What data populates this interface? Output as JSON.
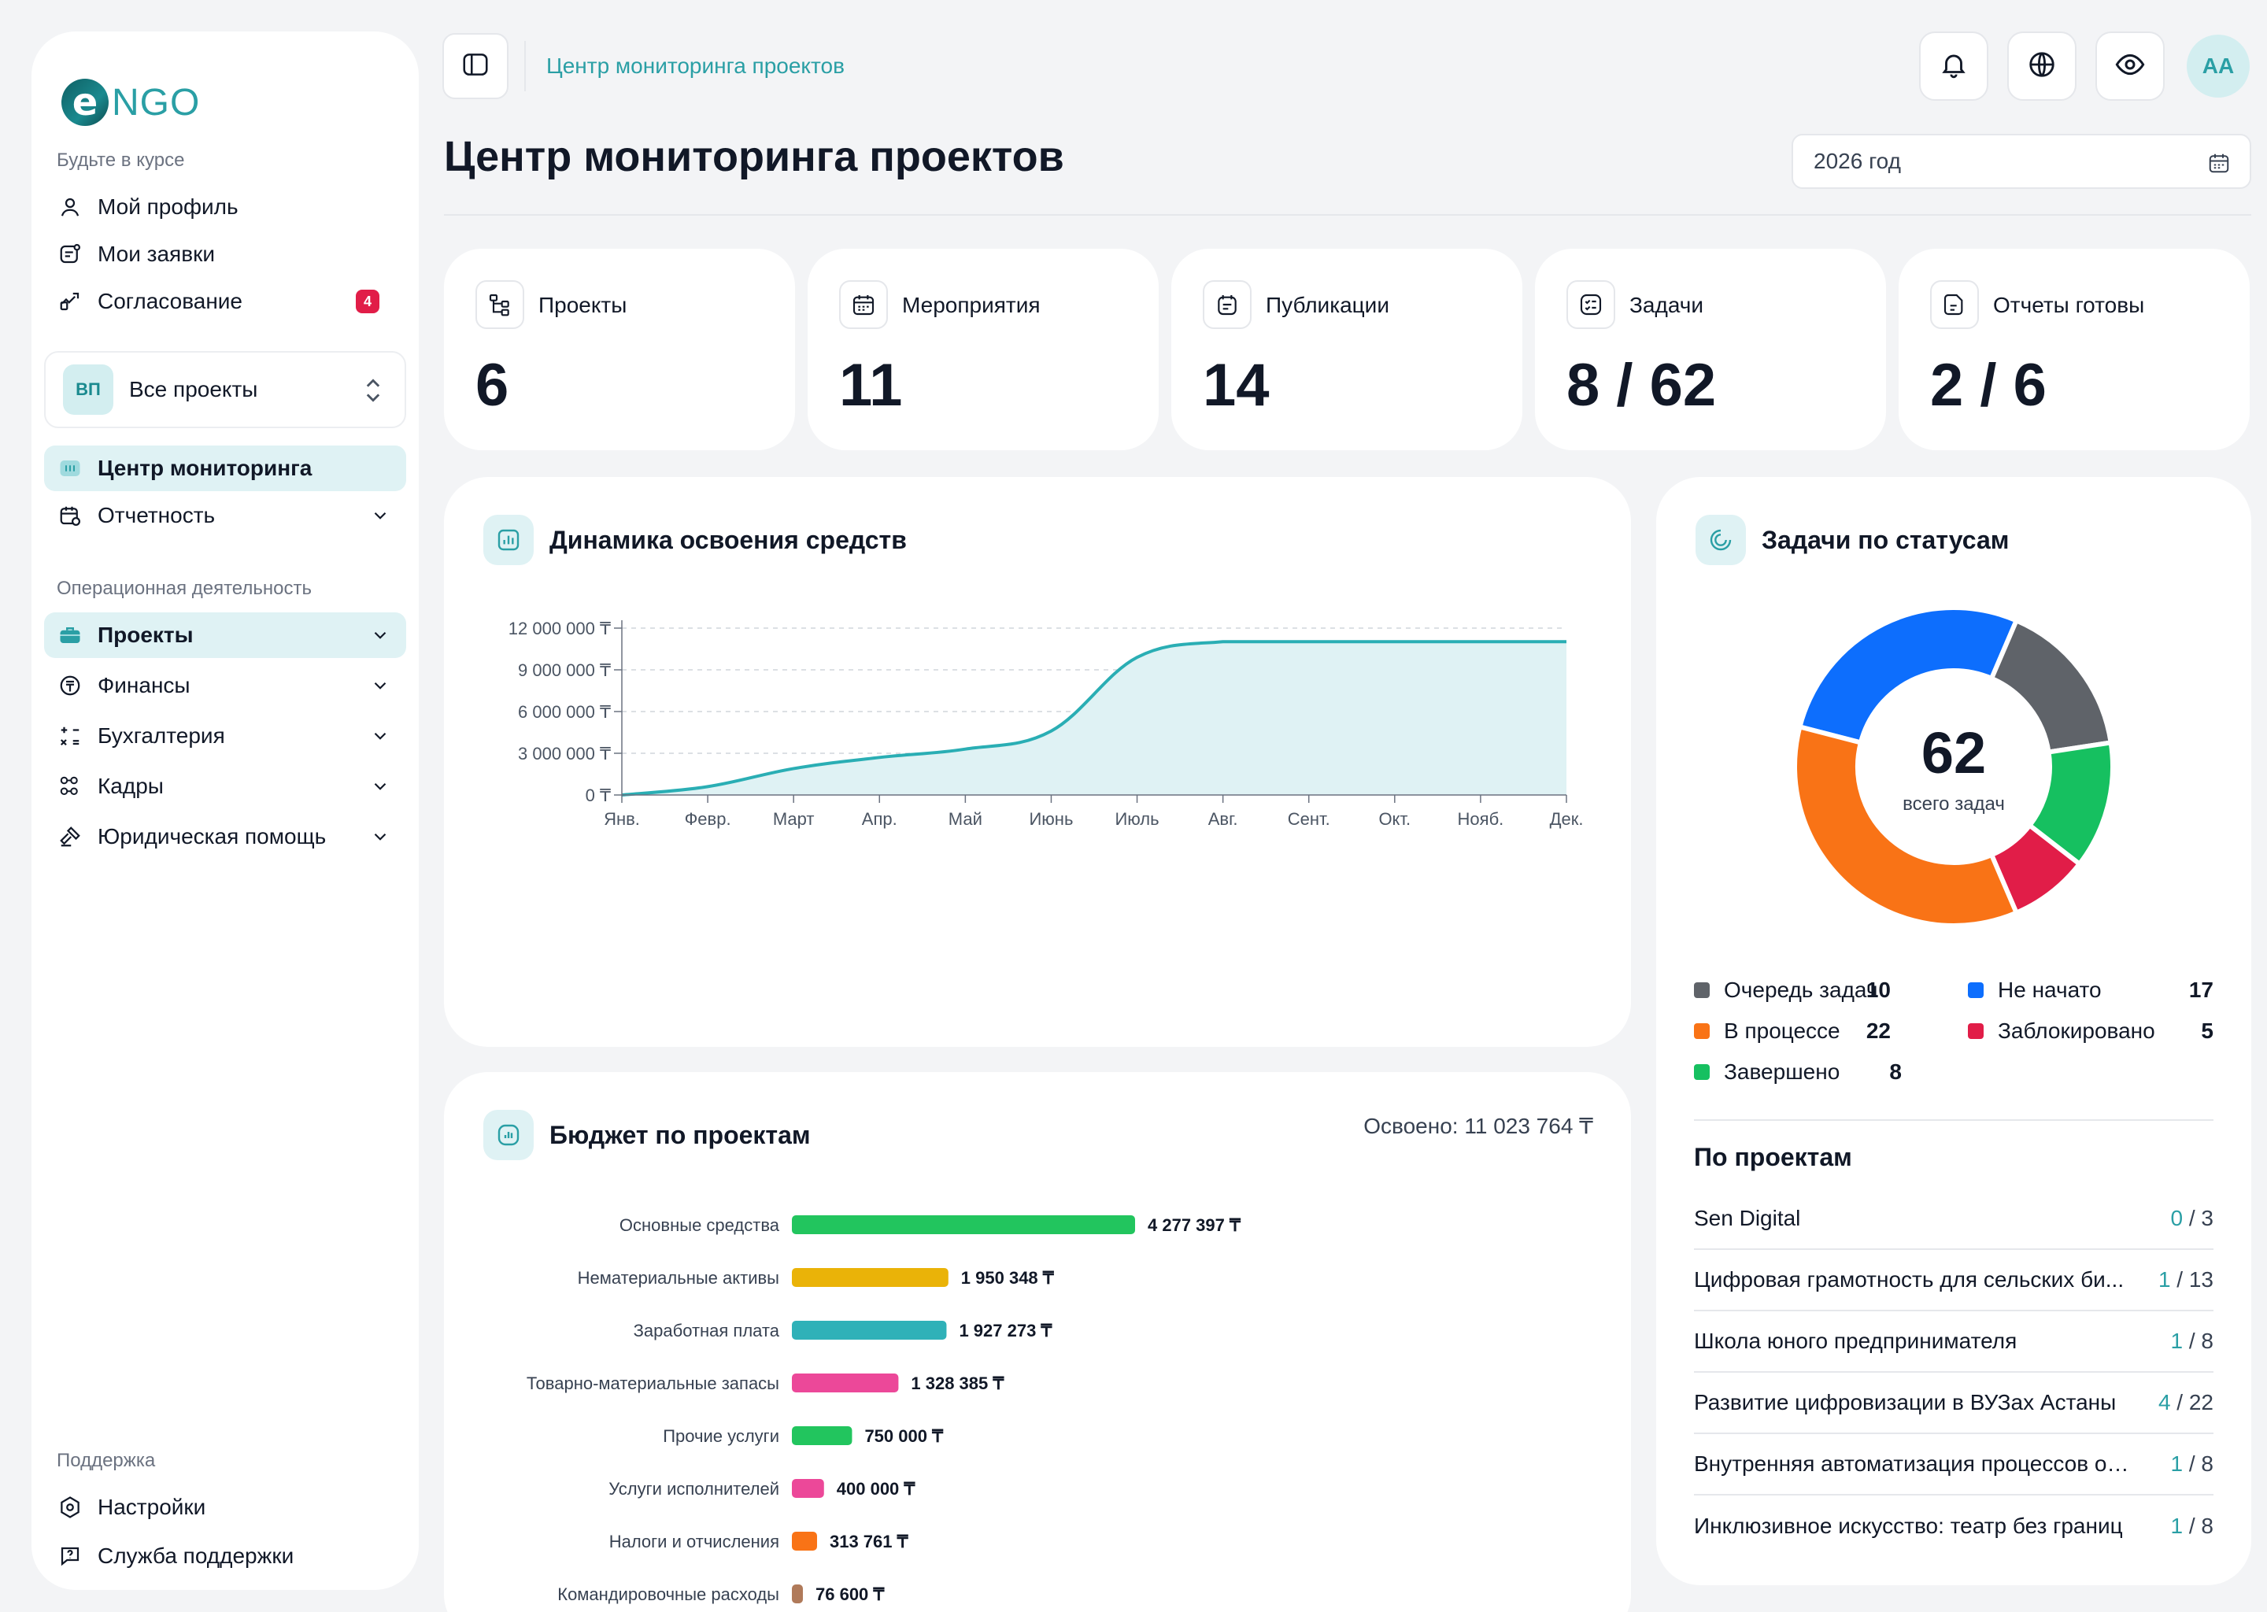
{
  "app": {
    "logo_text": "NGO",
    "logo_mark": "e"
  },
  "sidebar": {
    "section_stay": "Будьте в курсе",
    "profile": "Мой профиль",
    "requests": "Мои заявки",
    "approval": "Согласование",
    "approval_badge": "4",
    "project_switch": {
      "avatar": "ВП",
      "label": "Все проекты"
    },
    "monitoring": "Центр мониторинга",
    "reporting": "Отчетность",
    "section_ops": "Операционная деятельность",
    "projects": "Проекты",
    "finance": "Финансы",
    "accounting": "Бухгалтерия",
    "hr": "Кадры",
    "legal": "Юридическая помощь",
    "section_support": "Поддержка",
    "settings": "Настройки",
    "support": "Служба поддержки"
  },
  "header": {
    "breadcrumb": "Центр мониторинга проектов",
    "title": "Центр мониторинга проектов",
    "year": "2026 год",
    "user_initials": "АА"
  },
  "kpis": [
    {
      "label": "Проекты",
      "value": "6",
      "icon": "hierarchy-icon"
    },
    {
      "label": "Мероприятия",
      "value": "11",
      "icon": "calendar-icon"
    },
    {
      "label": "Публикации",
      "value": "14",
      "icon": "publication-icon"
    },
    {
      "label": "Задачи",
      "value": "8 / 62",
      "icon": "tasks-icon"
    },
    {
      "label": "Отчеты готовы",
      "value": "2 / 6",
      "icon": "report-icon"
    }
  ],
  "dynamics": {
    "title": "Динамика освоения средств"
  },
  "budget": {
    "title": "Бюджет по проектам",
    "spent": "Освоено: 11 023 764 ₸"
  },
  "tasks_status": {
    "title": "Задачи по статусам",
    "total": "62",
    "total_caption": "всего задач",
    "legend": [
      {
        "name": "Очередь задач",
        "value": "10",
        "color": "#5f6369"
      },
      {
        "name": "Не начато",
        "value": "17",
        "color": "#0d6efd"
      },
      {
        "name": "В процессе",
        "value": "22",
        "color": "#f97316"
      },
      {
        "name": "Заблокировано",
        "value": "5",
        "color": "#e11d48"
      },
      {
        "name": "Завершено",
        "value": "8",
        "color": "#16c060"
      }
    ]
  },
  "by_projects": {
    "title": "По проектам",
    "rows": [
      {
        "name": "Sen Digital",
        "done": "0",
        "total": "/ 3"
      },
      {
        "name": "Цифровая грамотность для сельских би...",
        "done": "1",
        "total": "/ 13"
      },
      {
        "name": "Школа юного предпринимателя",
        "done": "1",
        "total": "/ 8"
      },
      {
        "name": "Развитие цифровизации в ВУЗах Астаны",
        "done": "4",
        "total": "/ 22"
      },
      {
        "name": "Внутренняя автоматизация процессов ор...",
        "done": "1",
        "total": "/ 8"
      },
      {
        "name": "Инклюзивное искусство: театр без границ",
        "done": "1",
        "total": "/ 8"
      }
    ]
  },
  "chart_data": [
    {
      "type": "area",
      "title": "Динамика освоения средств",
      "categories": [
        "Янв.",
        "Февр.",
        "Март",
        "Апр.",
        "Май",
        "Июнь",
        "Июль",
        "Авг.",
        "Сент.",
        "Окт.",
        "Нояб.",
        "Дек."
      ],
      "x": [
        0,
        1,
        2,
        3,
        4,
        5,
        6,
        7,
        8,
        9,
        10,
        11
      ],
      "values": [
        0,
        600000,
        1900000,
        2700000,
        3300000,
        4600000,
        9900000,
        11023764,
        11023764,
        11023764,
        11023764,
        11023764
      ],
      "yticks": [
        "0 ₸",
        "3 000 000 ₸",
        "6 000 000 ₸",
        "9 000 000 ₸",
        "12 000 000 ₸"
      ],
      "ylim": [
        0,
        12000000
      ],
      "grid": true,
      "color": "#2aaeb4",
      "fill": "#dff2f4"
    },
    {
      "type": "bar",
      "orientation": "horizontal",
      "title": "Бюджет по проектам",
      "categories": [
        "Основные средства",
        "Нематериальные активы",
        "Заработная плата",
        "Товарно-материальные запасы",
        "Прочие услуги",
        "Услуги исполнителей",
        "Налоги и отчисления",
        "Командировочные расходы"
      ],
      "values": [
        4277397,
        1950348,
        1927273,
        1328385,
        750000,
        400000,
        313761,
        76600
      ],
      "labels": [
        "4 277 397 ₸",
        "1 950 348 ₸",
        "1 927 273 ₸",
        "1 328 385 ₸",
        "750 000 ₸",
        "400 000 ₸",
        "313 761 ₸",
        "76 600 ₸"
      ],
      "colors": [
        "#22c55e",
        "#eab308",
        "#2fb1b8",
        "#ec4899",
        "#22c55e",
        "#ec4899",
        "#f97316",
        "#b07a5a"
      ]
    },
    {
      "type": "pie",
      "title": "Задачи по статусам",
      "categories": [
        "Не начато",
        "Очередь задач",
        "Завершено",
        "Заблокировано",
        "В процессе"
      ],
      "values": [
        17,
        10,
        8,
        5,
        22
      ],
      "colors": [
        "#0d6efd",
        "#5f6369",
        "#16c060",
        "#e11d48",
        "#f97316"
      ]
    }
  ]
}
